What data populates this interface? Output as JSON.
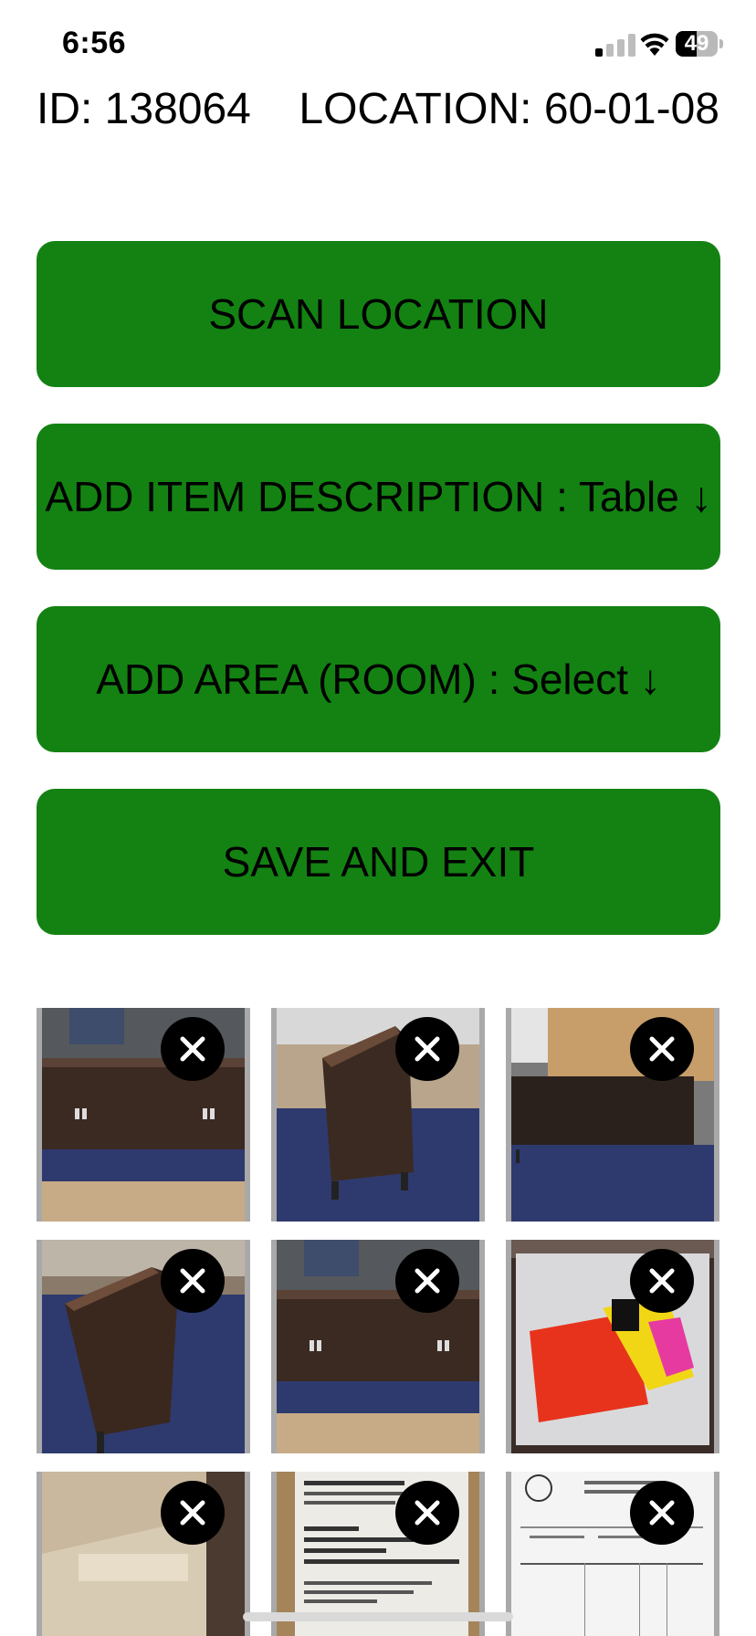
{
  "status_bar": {
    "time": "6:56",
    "battery_percent": "49",
    "battery_level": 0.49,
    "signal_bars_active": 1,
    "signal_bars_total": 4
  },
  "header": {
    "id_text": "ID: 138064",
    "location_text": "LOCATION: 60-01-08"
  },
  "buttons": {
    "scan_location": "SCAN LOCATION",
    "add_item_description": "ADD ITEM DESCRIPTION : Table ↓",
    "add_area": "ADD AREA (ROOM) : Select ↓",
    "save_and_exit": "SAVE AND EXIT"
  },
  "colors": {
    "button_green": "#138212",
    "photo_border": "#a9a9a9",
    "remove_button": "#000000"
  },
  "photos": [
    {
      "subject": "dark wood sideboard front on blue moving blanket"
    },
    {
      "subject": "dark wood sideboard end view on blue moving blanket"
    },
    {
      "subject": "dark sideboard front near cardboard boxes"
    },
    {
      "subject": "dark wood sideboard top angled view"
    },
    {
      "subject": "dark wood sideboard front on blue moving blanket"
    },
    {
      "subject": "red and yellow parts in plastic bag"
    },
    {
      "subject": "packaging close-up"
    },
    {
      "subject": "shipping label"
    },
    {
      "subject": "paper document"
    }
  ],
  "icons": {
    "remove_photo": "close-icon",
    "signal": "cellular-signal-icon",
    "wifi": "wifi-icon",
    "battery": "battery-icon"
  }
}
